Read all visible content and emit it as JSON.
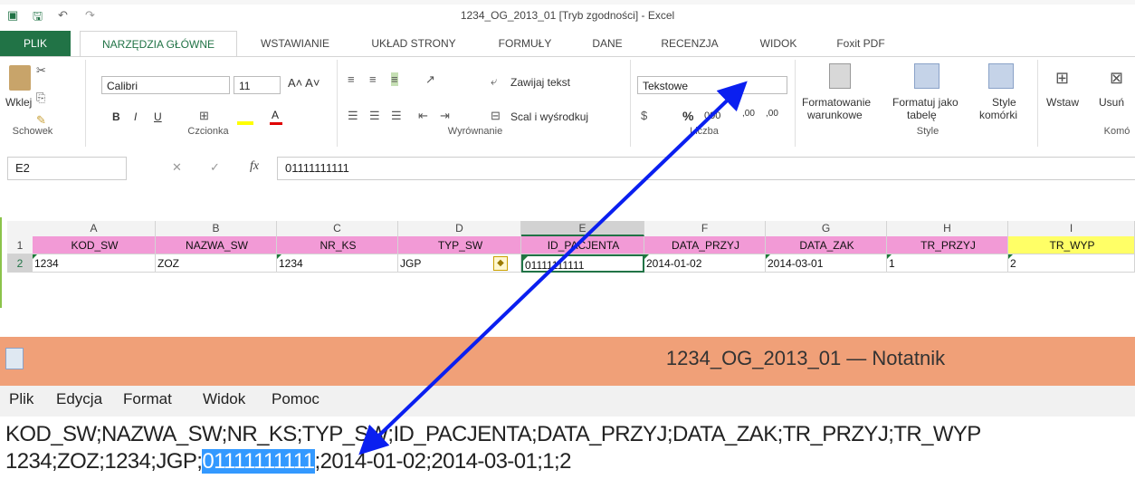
{
  "excel": {
    "title": "1234_OG_2013_01  [Tryb zgodności] - Excel",
    "tabs": [
      "PLIK",
      "NARZĘDZIA GŁÓWNE",
      "WSTAWIANIE",
      "UKŁAD STRONY",
      "FORMUŁY",
      "DANE",
      "RECENZJA",
      "WIDOK",
      "Foxit PDF"
    ],
    "ribbon": {
      "paste_label": "Wklej",
      "font_name": "Calibri",
      "font_size": "11",
      "wrap_text": "Zawijaj tekst",
      "merge_center": "Scal i wyśrodkuj",
      "number_format": "Tekstowe",
      "cond_format_1": "Formatowanie",
      "cond_format_2": "warunkowe",
      "format_table_1": "Formatuj jako",
      "format_table_2": "tabelę",
      "cell_styles_1": "Style",
      "cell_styles_2": "komórki",
      "insert": "Wstaw",
      "delete": "Usuń",
      "groups": {
        "clipboard": "Schowek",
        "font": "Czcionka",
        "alignment": "Wyrównanie",
        "number": "Liczba",
        "styles": "Style",
        "cells": "Komó"
      }
    },
    "namebox": "E2",
    "fx": "fx",
    "formula_value": "01111111111",
    "columns": [
      "A",
      "B",
      "C",
      "D",
      "E",
      "F",
      "G",
      "H",
      "I"
    ],
    "rows": [
      "1",
      "2"
    ],
    "header_row": [
      "KOD_SW",
      "NAZWA_SW",
      "NR_KS",
      "TYP_SW",
      "ID_PACJENTA",
      "DATA_PRZYJ",
      "DATA_ZAK",
      "TR_PRZYJ",
      "TR_WYP"
    ],
    "data_row": [
      "1234",
      "ZOZ",
      "1234",
      "JGP",
      "01111111111",
      "2014-01-02",
      "2014-03-01",
      "1",
      "2"
    ],
    "colors": {
      "header_pink": "#f29ad6",
      "header_yellow": "#ffff66",
      "accent_green": "#217346",
      "arrow": "#0a1ff0"
    }
  },
  "notepad": {
    "title": "1234_OG_2013_01 — Notatnik",
    "menu": [
      "Plik",
      "Edycja",
      "Format",
      "Widok",
      "Pomoc"
    ],
    "line1": "KOD_SW;NAZWA_SW;NR_KS;TYP_SW;ID_PACJENTA;DATA_PRZYJ;DATA_ZAK;TR_PRZYJ;TR_WYP",
    "line2_before": "1234;ZOZ;1234;JGP;",
    "line2_selected": "01111111111",
    "line2_after": ";2014-01-02;2014-03-01;1;2"
  }
}
